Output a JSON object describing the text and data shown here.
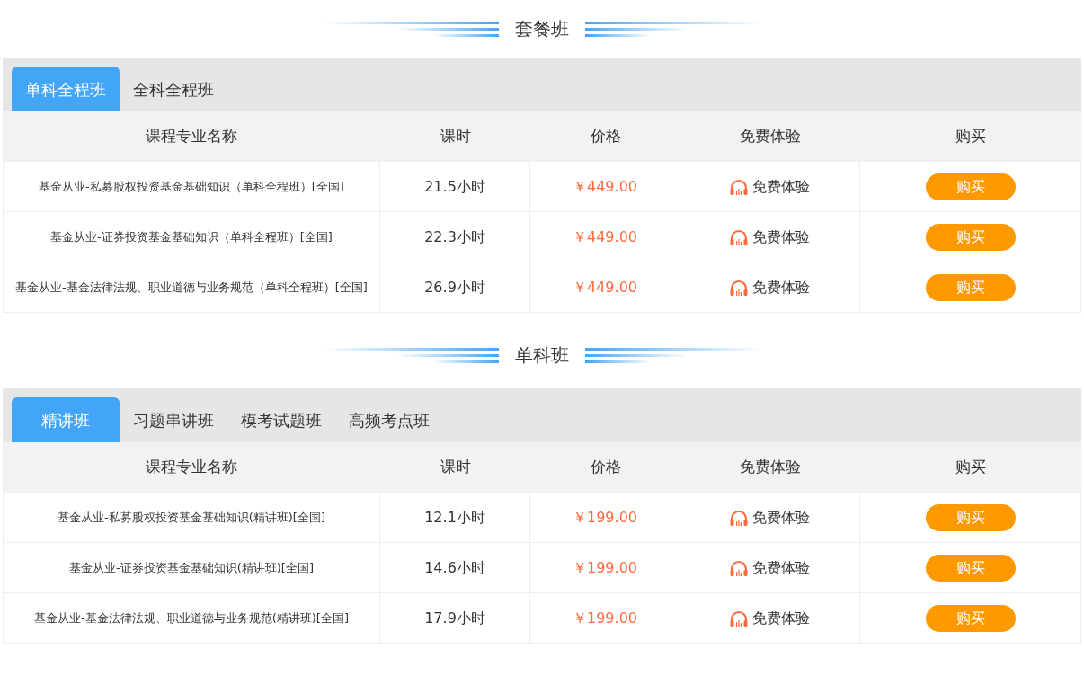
{
  "sections": [
    {
      "title": "套餐班",
      "tabs": [
        {
          "label": "单科全程班",
          "selected": true
        },
        {
          "label": "全科全程班",
          "selected": false
        }
      ],
      "columns": [
        "课程专业名称",
        "课时",
        "价格",
        "免费体验",
        "购买"
      ],
      "rows": [
        {
          "name": "基金从业-私募股权投资基金基础知识（单科全程班）[全国]",
          "hours": "21.5小时",
          "price": "￥449.00",
          "trial": "免费体验",
          "buy": "购买"
        },
        {
          "name": "基金从业-证券投资基金基础知识（单科全程班）[全国]",
          "hours": "22.3小时",
          "price": "￥449.00",
          "trial": "免费体验",
          "buy": "购买"
        },
        {
          "name": "基金从业-基金法律法规、职业道德与业务规范（单科全程班）[全国]",
          "hours": "26.9小时",
          "price": "￥449.00",
          "trial": "免费体验",
          "buy": "购买"
        }
      ]
    },
    {
      "title": "单科班",
      "tabs": [
        {
          "label": "精讲班",
          "selected": true
        },
        {
          "label": "习题串讲班",
          "selected": false
        },
        {
          "label": "模考试题班",
          "selected": false
        },
        {
          "label": "高频考点班",
          "selected": false
        }
      ],
      "columns": [
        "课程专业名称",
        "课时",
        "价格",
        "免费体验",
        "购买"
      ],
      "rows": [
        {
          "name": "基金从业-私募股权投资基金基础知识(精讲班)[全国]",
          "hours": "12.1小时",
          "price": "￥199.00",
          "trial": "免费体验",
          "buy": "购买"
        },
        {
          "name": "基金从业-证券投资基金基础知识(精讲班)[全国]",
          "hours": "14.6小时",
          "price": "￥199.00",
          "trial": "免费体验",
          "buy": "购买"
        },
        {
          "name": "基金从业-基金法律法规、职业道德与业务规范(精讲班)[全国]",
          "hours": "17.9小时",
          "price": "￥199.00",
          "trial": "免费体验",
          "buy": "购买"
        }
      ]
    }
  ]
}
